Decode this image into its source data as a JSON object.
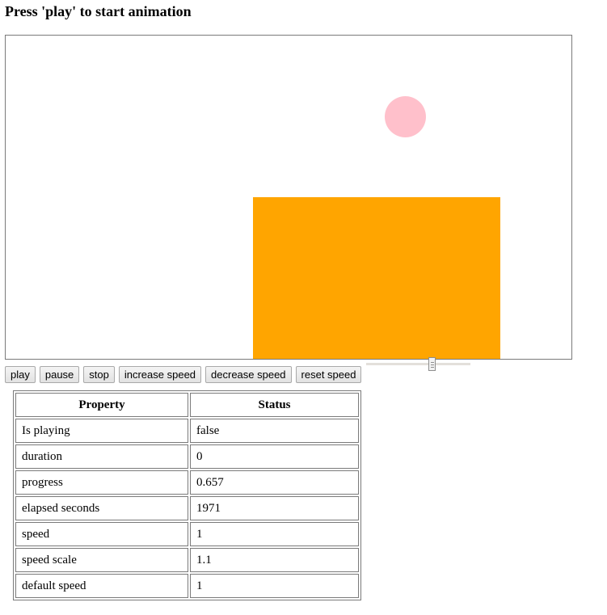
{
  "header": {
    "title": "Press 'play' to start animation"
  },
  "stage": {
    "ball_color": "#ffc0cb",
    "box_color": "#ffa500"
  },
  "controls": {
    "buttons": [
      {
        "id": "play",
        "label": "play"
      },
      {
        "id": "pause",
        "label": "pause"
      },
      {
        "id": "stop",
        "label": "stop"
      },
      {
        "id": "increase-speed",
        "label": "increase speed"
      },
      {
        "id": "decrease-speed",
        "label": "decrease speed"
      },
      {
        "id": "reset-speed",
        "label": "reset speed"
      }
    ],
    "speed_slider": {
      "fraction": 0.63
    }
  },
  "table": {
    "headers": [
      "Property",
      "Status"
    ],
    "rows": [
      {
        "property": "Is playing",
        "status": "false"
      },
      {
        "property": "duration",
        "status": "0"
      },
      {
        "property": "progress",
        "status": "0.657"
      },
      {
        "property": "elapsed seconds",
        "status": "1971"
      },
      {
        "property": "speed",
        "status": "1"
      },
      {
        "property": "speed scale",
        "status": "1.1"
      },
      {
        "property": "default speed",
        "status": "1"
      }
    ]
  }
}
